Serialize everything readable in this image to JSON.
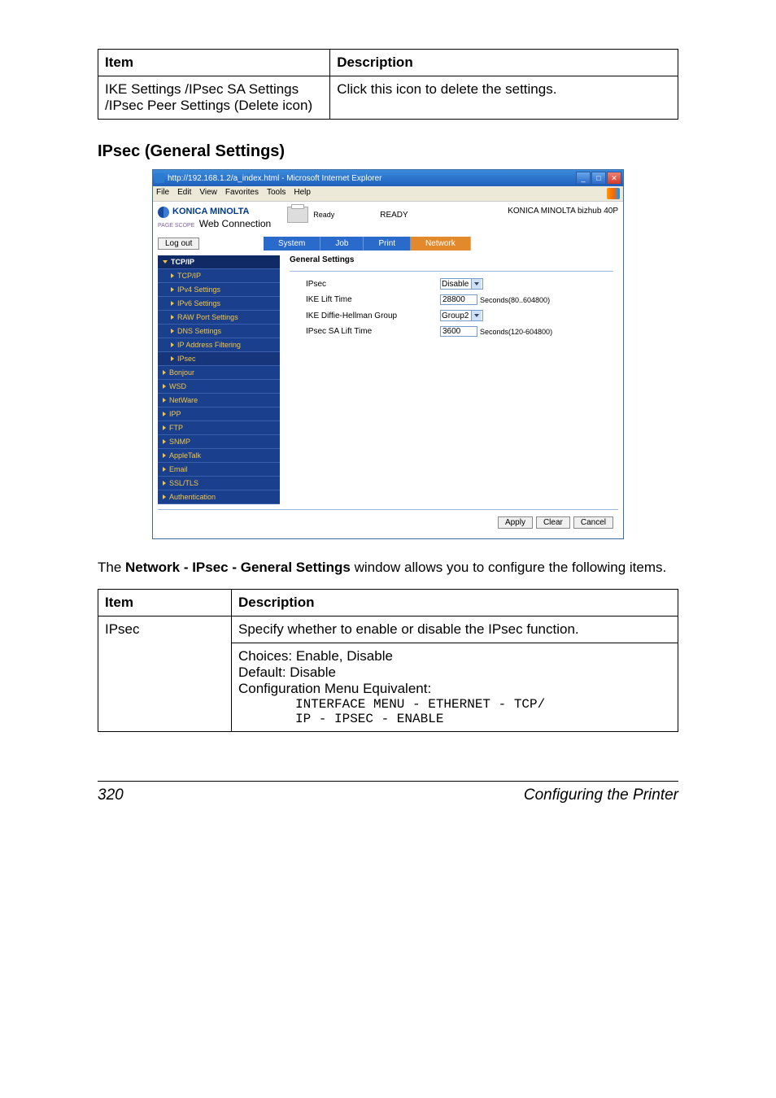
{
  "top_table": {
    "headers": [
      "Item",
      "Description"
    ],
    "rows": [
      {
        "item": "IKE Settings /IPsec SA Settings /IPsec Peer Settings (Delete icon)",
        "desc": "Click this icon to delete the settings."
      }
    ]
  },
  "section_heading": "IPsec (General Settings)",
  "ie_window": {
    "title": "http://192.168.1.2/a_index.html - Microsoft Internet Explorer",
    "menu": [
      "File",
      "Edit",
      "View",
      "Favorites",
      "Tools",
      "Help"
    ],
    "brand_top": "KONICA MINOLTA",
    "brand_ps": "PAGE\nSCOPE",
    "brand_bottom": "Web Connection",
    "status_text": "Ready",
    "ready_label": "READY",
    "model": "KONICA MINOLTA bizhub 40P",
    "logout": "Log out",
    "tabs": [
      "System",
      "Job",
      "Print",
      "Network"
    ],
    "sidebar": {
      "top": "TCP/IP",
      "subs": [
        "TCP/IP",
        "IPv4 Settings",
        "IPv6 Settings",
        "RAW Port Settings",
        "DNS Settings",
        "IP Address Filtering",
        "IPsec"
      ],
      "rest": [
        "Bonjour",
        "WSD",
        "NetWare",
        "IPP",
        "FTP",
        "SNMP",
        "AppleTalk",
        "Email",
        "SSL/TLS",
        "Authentication"
      ]
    },
    "panel": {
      "title": "General Settings",
      "rows": [
        {
          "label": "IPsec",
          "kind": "select",
          "value": "Disable"
        },
        {
          "label": "IKE Lift Time",
          "kind": "number",
          "value": "28800",
          "hint": "Seconds(80..604800)"
        },
        {
          "label": "IKE Diffie-Hellman Group",
          "kind": "select",
          "value": "Group2"
        },
        {
          "label": "IPsec SA Lift Time",
          "kind": "number",
          "value": "3600",
          "hint": "Seconds(120-604800)"
        }
      ],
      "buttons": [
        "Apply",
        "Clear",
        "Cancel"
      ]
    }
  },
  "body_paragraph_prefix": "The ",
  "body_paragraph_bold": "Network - IPsec - General Settings",
  "body_paragraph_suffix": " window allows you to configure the following items.",
  "bottom_table": {
    "headers": [
      "Item",
      "Description"
    ],
    "rows": [
      {
        "item": "IPsec",
        "desc_line1": "Specify whether to enable or disable the IPsec function.",
        "choices": "Choices: Enable, Disable",
        "default": "Default:  Disable",
        "cfg": "Configuration Menu Equivalent:",
        "mono1": "INTERFACE MENU - ETHERNET - TCP/",
        "mono2": "IP - IPSEC - ENABLE"
      }
    ]
  },
  "footer": {
    "page": "320",
    "text": "Configuring the Printer"
  }
}
